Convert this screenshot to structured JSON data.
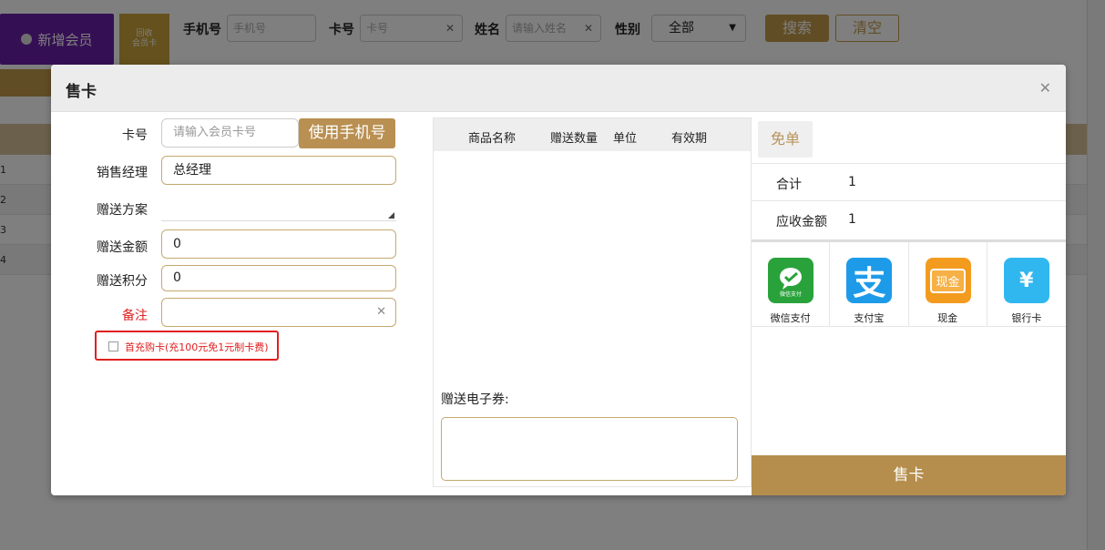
{
  "background": {
    "add_member_label": "新增会员",
    "recycle_label_1": "回收",
    "recycle_label_2": "会员卡",
    "phone_label": "手机号",
    "phone_placeholder": "手机号",
    "card_label": "卡号",
    "card_placeholder": "卡号",
    "name_label": "姓名",
    "name_placeholder": "请输入姓名",
    "gender_label": "性别",
    "gender_value": "全部",
    "search_label": "搜索",
    "clear_label": "清空",
    "row_numbers": [
      "1",
      "2",
      "3",
      "4"
    ]
  },
  "dialog": {
    "title": "售卡",
    "close_icon": "close-icon",
    "form": {
      "card_no_label": "卡号",
      "card_no_placeholder": "请输入会员卡号",
      "use_phone_label": "使用手机号",
      "sales_manager_label": "销售经理",
      "sales_manager_value": "总经理",
      "gift_plan_label": "赠送方案",
      "gift_amount_label": "赠送金额",
      "gift_amount_value": "0",
      "gift_points_label": "赠送积分",
      "gift_points_value": "0",
      "remark_label": "备注",
      "remark_value": "",
      "first_charge_text": "首充购卡(充100元免1元制卡费)"
    },
    "items_table": {
      "headers": [
        "商品名称",
        "赠送数量",
        "单位",
        "有效期"
      ],
      "rows": []
    },
    "coupon_label": "赠送电子券:",
    "summary": {
      "free_label": "免单",
      "total_label": "合计",
      "total_value": "1",
      "receivable_label": "应收金额",
      "receivable_value": "1"
    },
    "payments": [
      {
        "name": "微信支付",
        "icon": "wechat-pay-icon",
        "color": "#2aa23b",
        "badge": "微信支付"
      },
      {
        "name": "支付宝",
        "icon": "alipay-icon",
        "color": "#1e9be8",
        "badge": "支"
      },
      {
        "name": "现金",
        "icon": "cash-icon",
        "color": "#f39b1f",
        "badge": "现金"
      },
      {
        "name": "银行卡",
        "icon": "bank-card-icon",
        "color": "#31b7f0",
        "badge": "¥"
      }
    ],
    "sell_button_label": "售卡"
  },
  "colors": {
    "accent": "#b58e4d",
    "purple": "#6a1ea8",
    "warning": "#e02020"
  }
}
